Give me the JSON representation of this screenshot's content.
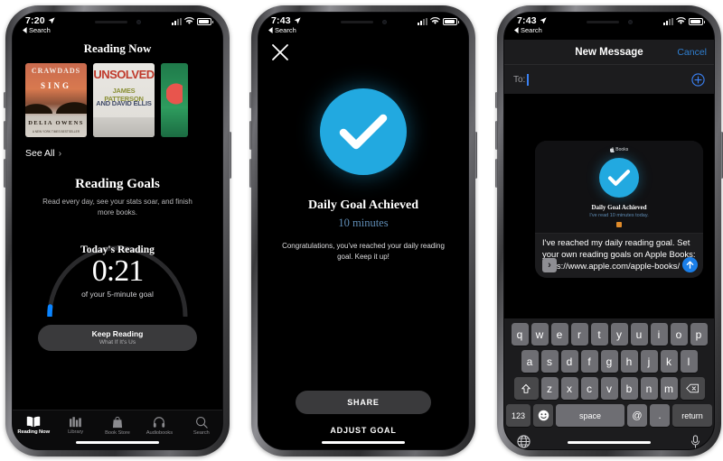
{
  "phone1": {
    "status": {
      "time": "7:20",
      "back_label": "Search",
      "location_icon": "location-arrow-icon"
    },
    "title": "Reading Now",
    "books": [
      {
        "title_top": "CRAWDADS",
        "title_mid": "SING",
        "author": "DELIA OWENS",
        "blurb": "A NEW YORK TIMES BESTSELLER"
      },
      {
        "title": "UNSOLVED",
        "author_line1": "JAMES PATTERSON",
        "author_line2": "AND DAVID ELLIS"
      },
      {
        "title": ""
      }
    ],
    "see_all": "See All",
    "goals_heading": "Reading Goals",
    "goals_sub": "Read every day, see your stats soar, and finish more books.",
    "ring": {
      "label": "Today's Reading",
      "value": "0:21",
      "of_text": "of your 5-minute goal",
      "progress_percent": 7,
      "accent": "#0a84ff"
    },
    "keep_button": {
      "title": "Keep Reading",
      "subtitle": "What If It's Us"
    },
    "tabs": [
      {
        "label": "Reading Now",
        "icon": "open-book-icon",
        "active": true
      },
      {
        "label": "Library",
        "icon": "books-shelf-icon",
        "active": false
      },
      {
        "label": "Book Store",
        "icon": "shopping-bag-icon",
        "active": false
      },
      {
        "label": "Audiobooks",
        "icon": "headphones-icon",
        "active": false
      },
      {
        "label": "Search",
        "icon": "search-icon",
        "active": false
      }
    ]
  },
  "phone2": {
    "status": {
      "time": "7:43",
      "back_label": "Search",
      "location_icon": "location-arrow-icon"
    },
    "close_icon": "close-x-icon",
    "check_icon": "checkmark-icon",
    "heading": "Daily Goal Achieved",
    "minutes": "10 minutes",
    "body": "Congratulations, you've reached your daily reading goal. Keep it up!",
    "share_button": "SHARE",
    "adjust_button": "ADJUST GOAL",
    "accent": "#22a9e0",
    "minutes_color": "#5f8cb5"
  },
  "phone3": {
    "status": {
      "time": "7:43",
      "back_label": "Search",
      "location_icon": "location-arrow-icon"
    },
    "nav": {
      "title": "New Message",
      "cancel": "Cancel",
      "cancel_color": "#2f7fd0"
    },
    "to_field": {
      "label": "To:",
      "value": "",
      "add_contact_icon": "plus-circle-icon"
    },
    "card": {
      "brand": "Books",
      "brand_icon": "apple-logo-icon",
      "heading": "Daily Goal Achieved",
      "subtitle": "I've read 10 minutes today."
    },
    "message_text": "I've reached my daily reading goal. Set your own reading goals on Apple Books: https://www.apple.com/apple-books/",
    "expand_icon": "chevron-right-icon",
    "send_icon": "send-arrow-up-icon",
    "keyboard": {
      "row1": [
        "q",
        "w",
        "e",
        "r",
        "t",
        "y",
        "u",
        "i",
        "o",
        "p"
      ],
      "row2": [
        "a",
        "s",
        "d",
        "f",
        "g",
        "h",
        "j",
        "k",
        "l"
      ],
      "row3": {
        "shift": "shift-icon",
        "keys": [
          "z",
          "x",
          "c",
          "v",
          "b",
          "n",
          "m"
        ],
        "backspace": "backspace-icon"
      },
      "row4": {
        "numbers": "123",
        "emoji": "emoji-icon",
        "space": "space",
        "at": "@",
        "period": ".",
        "return": "return"
      },
      "bottom": {
        "globe": "globe-icon",
        "mic": "microphone-icon"
      }
    }
  }
}
